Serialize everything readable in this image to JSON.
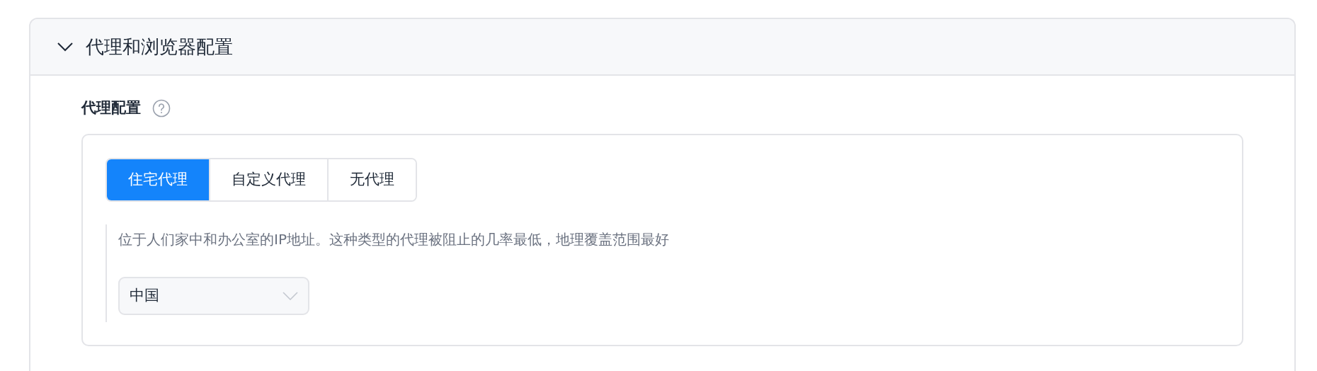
{
  "section": {
    "title": "代理和浏览器配置",
    "expanded": true
  },
  "proxy_config": {
    "label": "代理配置",
    "tabs": [
      {
        "label": "住宅代理",
        "selected": true
      },
      {
        "label": "自定义代理",
        "selected": false
      },
      {
        "label": "无代理",
        "selected": false
      }
    ],
    "description": "位于人们家中和办公室的IP地址。这种类型的代理被阻止的几率最低，地理覆盖范围最好",
    "country_select": {
      "value": "中国"
    }
  }
}
